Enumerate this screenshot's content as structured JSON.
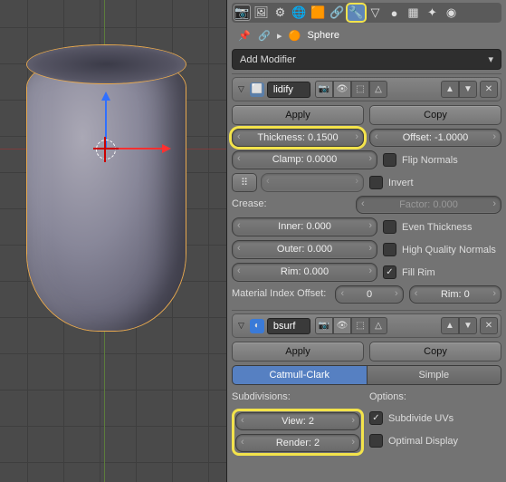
{
  "header": {
    "object_name": "Sphere"
  },
  "add_modifier": "Add Modifier",
  "solidify": {
    "name": "lidify",
    "apply": "Apply",
    "copy": "Copy",
    "thickness": "Thickness: 0.1500",
    "offset": "Offset: -1.0000",
    "clamp": "Clamp: 0.0000",
    "flip": "Flip Normals",
    "invert": "Invert",
    "crease": "Crease:",
    "factor": "Factor: 0.000",
    "inner": "Inner: 0.000",
    "even": "Even Thickness",
    "outer": "Outer: 0.000",
    "hq": "High Quality Normals",
    "rim": "Rim: 0.000",
    "fillrim": "Fill Rim",
    "matoff": "Material Index Offset:",
    "matoff_v": "0",
    "rim_v": "Rim: 0"
  },
  "subsurf": {
    "name": "bsurf",
    "apply": "Apply",
    "copy": "Copy",
    "catmull": "Catmull-Clark",
    "simple": "Simple",
    "subdiv": "Subdivisions:",
    "options": "Options:",
    "view": "View: 2",
    "render": "Render: 2",
    "subuvs": "Subdivide UVs",
    "optdisp": "Optimal Display"
  },
  "icons": {
    "pin": "📌",
    "link": "🔗",
    "sphere": "🟠",
    "camera": "📷",
    "eye": "👁",
    "cage": "⬚",
    "cube": "🔲",
    "up": "▲",
    "down": "▼",
    "close": "✕",
    "dots": "⠿"
  }
}
